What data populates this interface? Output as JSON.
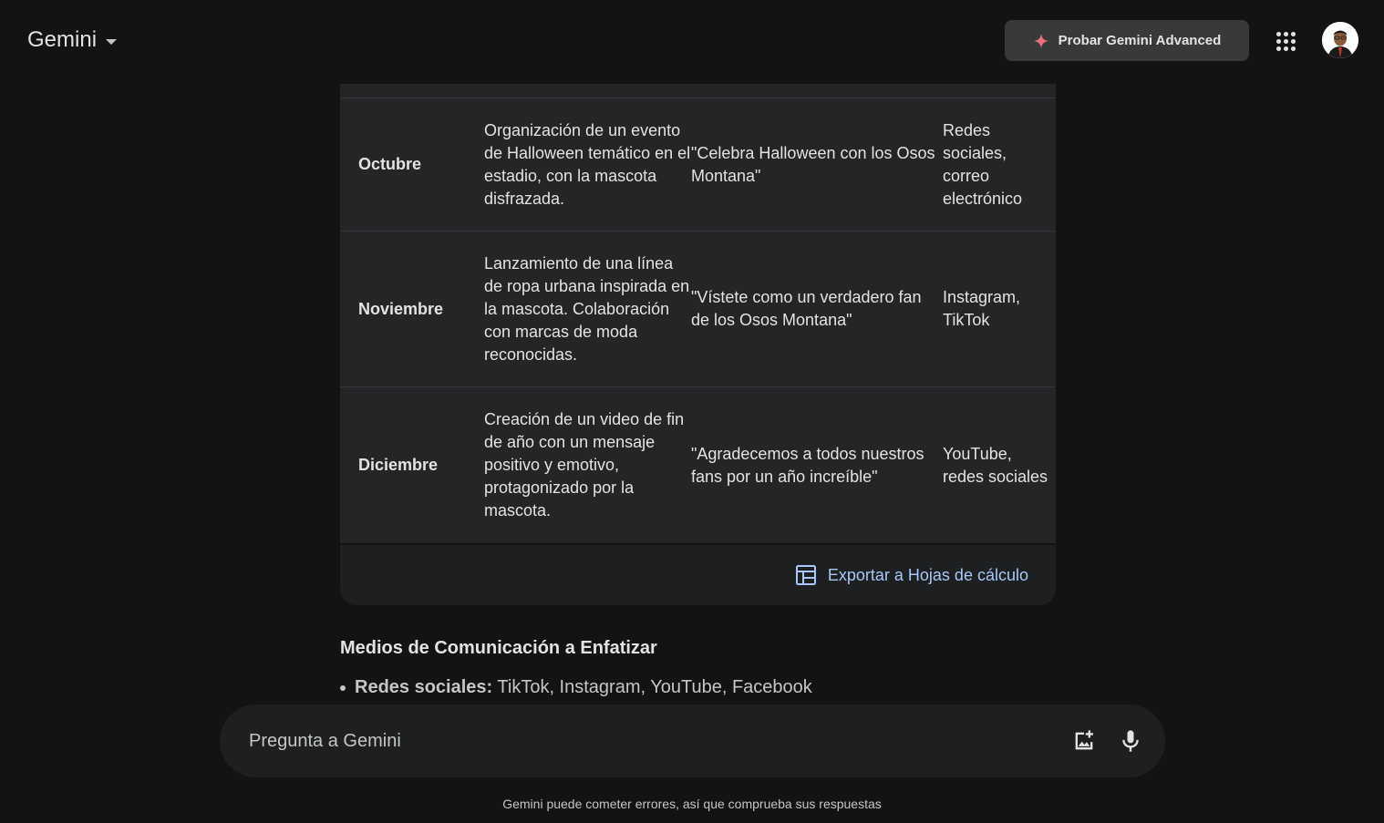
{
  "header": {
    "brand": "Gemini",
    "advanced_button": "Probar Gemini Advanced"
  },
  "table": {
    "rows": [
      {
        "month": "Octubre",
        "action": "Organización de un evento de Halloween temático en el estadio, con la mascota disfrazada.",
        "slogan": "\"Celebra Halloween con los Osos Montana\"",
        "channels": "Redes sociales, correo electrónico"
      },
      {
        "month": "Noviembre",
        "action": "Lanzamiento de una línea de ropa urbana inspirada en la mascota. Colaboración con marcas de moda reconocidas.",
        "slogan": "\"Vístete como un verdadero fan de los Osos Montana\"",
        "channels": "Instagram, TikTok"
      },
      {
        "month": "Diciembre",
        "action": "Creación de un video de fin de año con un mensaje positivo y emotivo, protagonizado por la mascota.",
        "slogan": "\"Agradecemos a todos nuestros fans por un año increíble\"",
        "channels": "YouTube, redes sociales"
      }
    ],
    "export_label": "Exportar a Hojas de cálculo"
  },
  "section": {
    "title": "Medios de Comunicación a Enfatizar",
    "bullet_label": "Redes sociales:",
    "bullet_text": " TikTok, Instagram, YouTube, Facebook"
  },
  "input": {
    "placeholder": "Pregunta a Gemini"
  },
  "footer": {
    "disclaimer": "Gemini puede cometer errores, así que comprueba sus respuestas"
  },
  "colors": {
    "background": "#131314",
    "table_bg": "#242527",
    "link": "#a8c7fa",
    "sparkle": "#e8707a"
  }
}
